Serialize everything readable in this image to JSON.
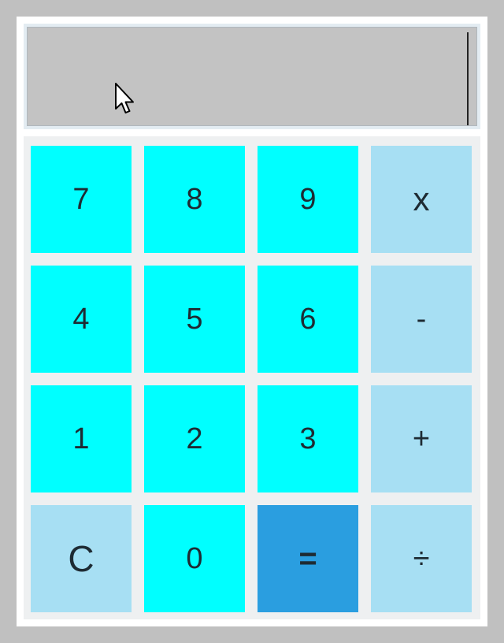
{
  "display": {
    "value": ""
  },
  "keys": {
    "k7": "7",
    "k8": "8",
    "k9": "9",
    "multiply": "x",
    "k4": "4",
    "k5": "5",
    "k6": "6",
    "subtract": "-",
    "k1": "1",
    "k2": "2",
    "k3": "3",
    "add": "+",
    "clear": "C",
    "k0": "0",
    "equals": "=",
    "divide": "÷"
  },
  "colors": {
    "digit_key": "#00ffff",
    "operator_key": "#a7dff3",
    "equals_key": "#2a9ee0",
    "display_bg": "#c3c3c3",
    "page_bg": "#c0c0c0"
  }
}
